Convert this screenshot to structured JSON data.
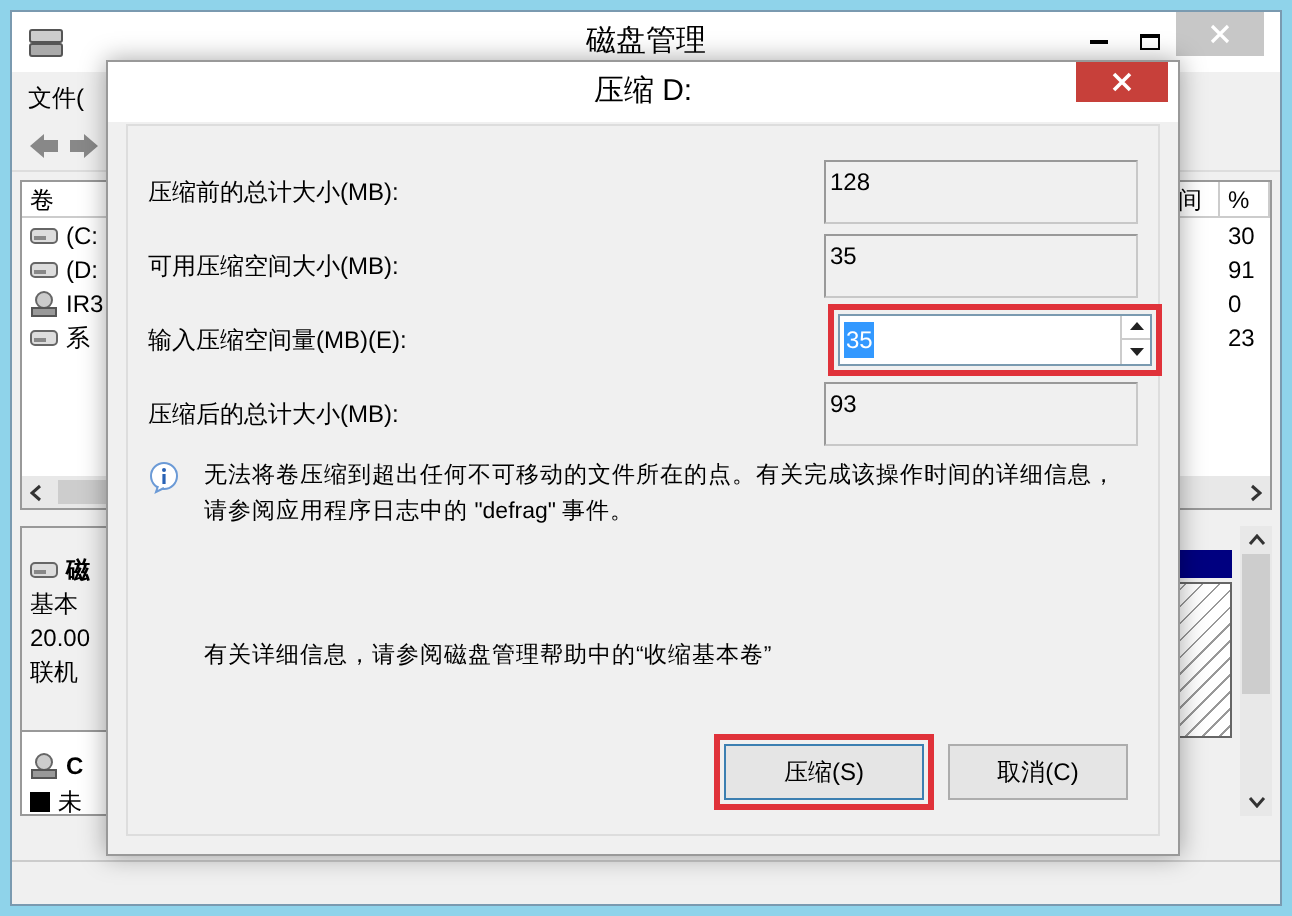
{
  "window": {
    "title": "磁盘管理"
  },
  "menu": [
    "文件("
  ],
  "volume_list": {
    "header": "卷",
    "rows": [
      "(C:",
      "(D:",
      "IR3",
      "系"
    ],
    "right_header": [
      "间",
      "%"
    ],
    "right_values": [
      "30",
      "91",
      "0",
      "23"
    ]
  },
  "disk_panel": {
    "disks": [
      {
        "kind": "disk",
        "name": "磁",
        "lines": [
          "基本",
          "20.00",
          "联机"
        ]
      },
      {
        "kind": "cdrom",
        "name": "C"
      }
    ],
    "legend": "未"
  },
  "dialog": {
    "title": "压缩 D:",
    "fields": [
      {
        "label": "压缩前的总计大小(MB):",
        "value": "128",
        "kind": "readonly",
        "highlighted": false
      },
      {
        "label": "可用压缩空间大小(MB):",
        "value": "35",
        "kind": "readonly",
        "highlighted": false
      },
      {
        "label": "输入压缩空间量(MB)(E):",
        "value": "35",
        "kind": "spin",
        "highlighted": true,
        "text_selected": true
      },
      {
        "label": "压缩后的总计大小(MB):",
        "value": "93",
        "kind": "readonly",
        "highlighted": false
      }
    ],
    "info": "无法将卷压缩到超出任何不可移动的文件所在的点。有关完成该操作时间的详细信息，请参阅应用程序日志中的 \"defrag\" 事件。",
    "help": "有关详细信息，请参阅磁盘管理帮助中的“收缩基本卷”",
    "buttons": [
      {
        "label": "压缩(S)",
        "highlighted": true
      },
      {
        "label": "取消(C)",
        "highlighted": false
      }
    ]
  }
}
